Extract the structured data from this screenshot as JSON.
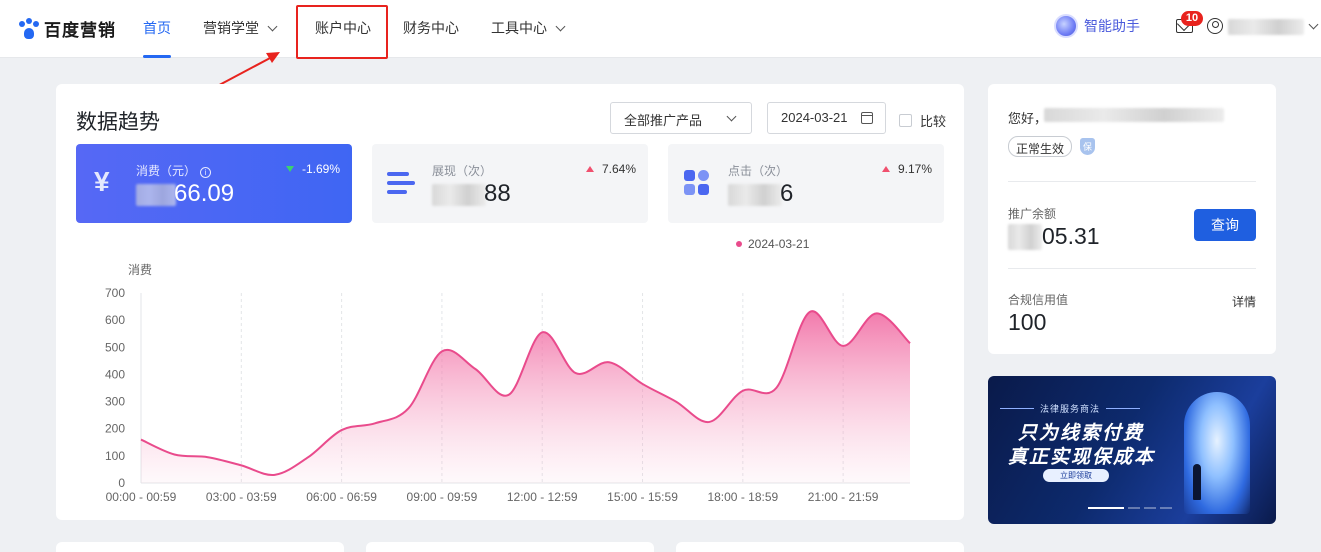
{
  "nav": {
    "logo_text": "百度营销",
    "items": [
      {
        "label": "首页"
      },
      {
        "label": "营销学堂"
      },
      {
        "label": "账户中心"
      },
      {
        "label": "财务中心"
      },
      {
        "label": "工具中心"
      }
    ],
    "assistant_label": "智能助手",
    "message_count": "10"
  },
  "toolbar": {
    "title": "数据趋势",
    "product_select": "全部推广产品",
    "date": "2024-03-21",
    "compare_label": "比较"
  },
  "metrics": [
    {
      "label": "消费（元）",
      "value": "66.09",
      "change": "-1.69%",
      "direction": "down"
    },
    {
      "label": "展现（次）",
      "value": "88",
      "change": "7.64%",
      "direction": "up"
    },
    {
      "label": "点击（次）",
      "value": "6",
      "change": "9.17%",
      "direction": "up"
    }
  ],
  "legend_label": "2024-03-21",
  "chart_data": {
    "type": "area",
    "ylabel": "消费",
    "ylim": [
      0,
      700
    ],
    "yticks": [
      0,
      100,
      200,
      300,
      400,
      500,
      600,
      700
    ],
    "xtick_labels": [
      "00:00 - 00:59",
      "03:00 - 03:59",
      "06:00 - 06:59",
      "09:00 - 09:59",
      "12:00 - 12:59",
      "15:00 - 15:59",
      "18:00 - 18:59",
      "21:00 - 21:59"
    ],
    "x": [
      "00:00 - 00:59",
      "01:00 - 01:59",
      "02:00 - 02:59",
      "03:00 - 03:59",
      "04:00 - 04:59",
      "05:00 - 05:59",
      "06:00 - 06:59",
      "07:00 - 07:59",
      "08:00 - 08:59",
      "09:00 - 09:59",
      "10:00 - 10:59",
      "11:00 - 11:59",
      "12:00 - 12:59",
      "13:00 - 13:59",
      "14:00 - 14:59",
      "15:00 - 15:59",
      "16:00 - 16:59",
      "17:00 - 17:59",
      "18:00 - 18:59",
      "19:00 - 19:59",
      "20:00 - 20:59",
      "21:00 - 21:59",
      "22:00 - 22:59",
      "23:00 - 23:59"
    ],
    "series": [
      {
        "name": "2024-03-21",
        "values": [
          160,
          105,
          95,
          65,
          30,
          95,
          195,
          220,
          275,
          485,
          420,
          325,
          555,
          405,
          445,
          365,
          300,
          225,
          340,
          350,
          630,
          505,
          625,
          515
        ]
      }
    ],
    "color": "#e94b8c",
    "grid": "vertical-dashed"
  },
  "account": {
    "greeting": "您好，",
    "status": "正常生效",
    "balance_label": "推广余额",
    "balance_value": "05.31",
    "query_button": "查询",
    "credit_label": "合规信用值",
    "credit_value": "100",
    "detail_link": "详情"
  },
  "banner": {
    "subtitle": "法律服务商法",
    "line1": "只为线索付费",
    "line2": "真正实现保成本",
    "button": "立即领取"
  },
  "colors": {
    "brand": "#2468f2",
    "highlight": "#e8231e",
    "metric_active_bg": "#4b67f4"
  }
}
